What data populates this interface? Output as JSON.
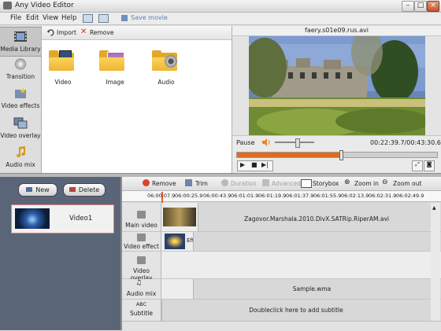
{
  "window": {
    "title": "Any Video Editor"
  },
  "menu": {
    "items": [
      "File",
      "Edit",
      "View",
      "Help"
    ],
    "save_movie": "Save movie"
  },
  "sidebar": {
    "items": [
      {
        "label": "Media Library",
        "icon": "film-icon"
      },
      {
        "label": "Transition",
        "icon": "transition-icon"
      },
      {
        "label": "Video effects",
        "icon": "effects-icon"
      },
      {
        "label": "Video overlay",
        "icon": "overlay-icon"
      },
      {
        "label": "Audio mix",
        "icon": "music-icon"
      }
    ]
  },
  "library": {
    "import_label": "Import",
    "remove_label": "Remove",
    "folders": [
      {
        "label": "Video",
        "icon": "video-folder-icon"
      },
      {
        "label": "Image",
        "icon": "image-folder-icon"
      },
      {
        "label": "Audio",
        "icon": "audio-folder-icon"
      }
    ]
  },
  "preview": {
    "filename": "faery.s01e09.rus.avi",
    "state": "Pause",
    "current_time": "00:22:39.7",
    "total_time": "00:43:30.6",
    "progress_fraction": 0.52,
    "volume_fraction": 0.55
  },
  "project": {
    "new_label": "New",
    "delete_label": "Delete",
    "items": [
      {
        "label": "Video1"
      }
    ]
  },
  "timeline": {
    "toolbar": {
      "remove": "Remove",
      "trim": "Trim",
      "duration": "Duration",
      "advanced": "Advanced",
      "storybox": "Storybox",
      "zoom_in": "Zoom in",
      "zoom_out": "Zoom out"
    },
    "ruler_ticks": [
      "06:00:07.9",
      "06:00:25.9",
      "06:00:43.9",
      "06:01:01.9",
      "06:01:19.9",
      "06:01:37.9",
      "06:01:55.9",
      "06:02:13.9",
      "06:02:31.9",
      "06:02:49.9"
    ],
    "tracks": [
      {
        "label": "Main video",
        "clip": "Zagovor.Marshala.2010.DivX.SATRip.RiperAM.avi"
      },
      {
        "label": "Video effect",
        "clip": "Eff"
      },
      {
        "label": "Video overlay",
        "clip": ""
      },
      {
        "label": "Audio mix",
        "clip": "Sample.wma"
      },
      {
        "label": "Subtitle",
        "clip": "Doubleclick here to add subtitle"
      }
    ],
    "subtitle_label_prefix": "ABC"
  },
  "colors": {
    "accent": "#e05a1e",
    "progress": "#e06a1e",
    "panel_dark": "#5a6678"
  }
}
